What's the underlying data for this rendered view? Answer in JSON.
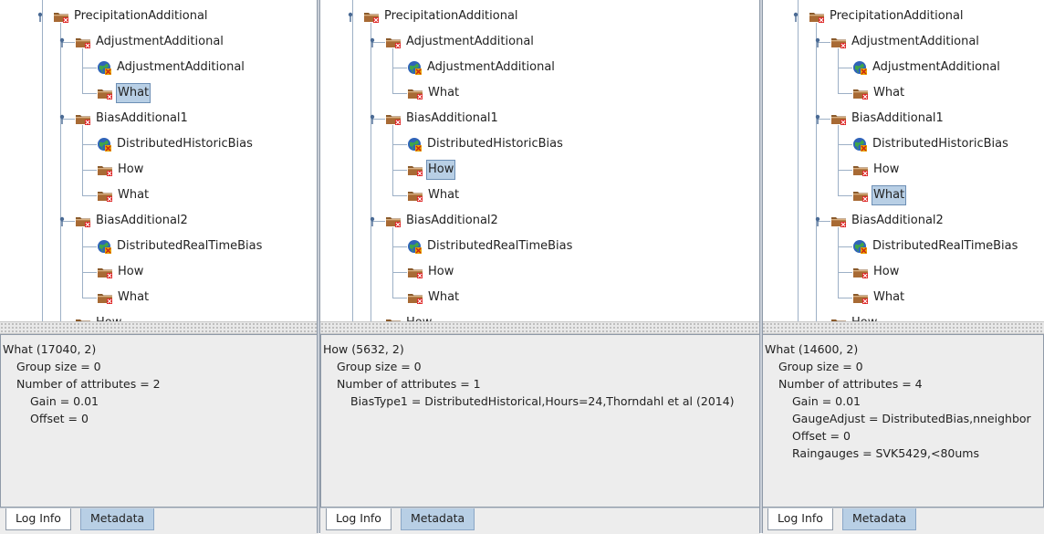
{
  "panes": [
    {
      "tree": [
        {
          "label": "PrecipitationAdditional",
          "icon": "folder-icon"
        },
        {
          "label": "AdjustmentAdditional",
          "icon": "folder-icon"
        },
        {
          "label": "AdjustmentAdditional",
          "icon": "globe-icon"
        },
        {
          "label": "What",
          "icon": "folder-icon",
          "selected": true
        },
        {
          "label": "BiasAdditional1",
          "icon": "folder-icon"
        },
        {
          "label": "DistributedHistoricBias",
          "icon": "globe-icon"
        },
        {
          "label": "How",
          "icon": "folder-icon"
        },
        {
          "label": "What",
          "icon": "folder-icon"
        },
        {
          "label": "BiasAdditional2",
          "icon": "folder-icon"
        },
        {
          "label": "DistributedRealTimeBias",
          "icon": "globe-icon"
        },
        {
          "label": "How",
          "icon": "folder-icon"
        },
        {
          "label": "What",
          "icon": "folder-icon"
        },
        {
          "label": "How",
          "icon": "folder-icon"
        }
      ],
      "info": [
        "What (17040, 2)",
        "Group size = 0",
        "Number of attributes = 2",
        "Gain = 0.01",
        "Offset = 0"
      ],
      "tabs": {
        "log": "Log Info",
        "metadata": "Metadata"
      }
    },
    {
      "tree": [
        {
          "label": "PrecipitationAdditional",
          "icon": "folder-icon"
        },
        {
          "label": "AdjustmentAdditional",
          "icon": "folder-icon"
        },
        {
          "label": "AdjustmentAdditional",
          "icon": "globe-icon"
        },
        {
          "label": "What",
          "icon": "folder-icon"
        },
        {
          "label": "BiasAdditional1",
          "icon": "folder-icon"
        },
        {
          "label": "DistributedHistoricBias",
          "icon": "globe-icon"
        },
        {
          "label": "How",
          "icon": "folder-icon",
          "selected": true
        },
        {
          "label": "What",
          "icon": "folder-icon"
        },
        {
          "label": "BiasAdditional2",
          "icon": "folder-icon"
        },
        {
          "label": "DistributedRealTimeBias",
          "icon": "globe-icon"
        },
        {
          "label": "How",
          "icon": "folder-icon"
        },
        {
          "label": "What",
          "icon": "folder-icon"
        },
        {
          "label": "How",
          "icon": "folder-icon"
        }
      ],
      "info": [
        "How (5632, 2)",
        "Group size = 0",
        "Number of attributes = 1",
        "BiasType1 = DistributedHistorical,Hours=24,Thorndahl et al (2014)"
      ],
      "tabs": {
        "log": "Log Info",
        "metadata": "Metadata"
      }
    },
    {
      "tree": [
        {
          "label": "PrecipitationAdditional",
          "icon": "folder-icon"
        },
        {
          "label": "AdjustmentAdditional",
          "icon": "folder-icon"
        },
        {
          "label": "AdjustmentAdditional",
          "icon": "globe-icon"
        },
        {
          "label": "What",
          "icon": "folder-icon"
        },
        {
          "label": "BiasAdditional1",
          "icon": "folder-icon"
        },
        {
          "label": "DistributedHistoricBias",
          "icon": "globe-icon"
        },
        {
          "label": "How",
          "icon": "folder-icon"
        },
        {
          "label": "What",
          "icon": "folder-icon",
          "selected": true
        },
        {
          "label": "BiasAdditional2",
          "icon": "folder-icon"
        },
        {
          "label": "DistributedRealTimeBias",
          "icon": "globe-icon"
        },
        {
          "label": "How",
          "icon": "folder-icon"
        },
        {
          "label": "What",
          "icon": "folder-icon"
        },
        {
          "label": "How",
          "icon": "folder-icon"
        }
      ],
      "info": [
        "What (14600, 2)",
        "Group size = 0",
        "Number of attributes = 4",
        "Gain = 0.01",
        "GaugeAdjust = DistributedBias,nneighbor",
        "Offset = 0",
        "Raingauges = SVK5429,<80ums"
      ],
      "tabs": {
        "log": "Log Info",
        "metadata": "Metadata"
      }
    }
  ],
  "colors": {
    "selection": "#b8cfe5",
    "folder": "#7a4a1e",
    "tab_active": "#b8cfe5"
  }
}
